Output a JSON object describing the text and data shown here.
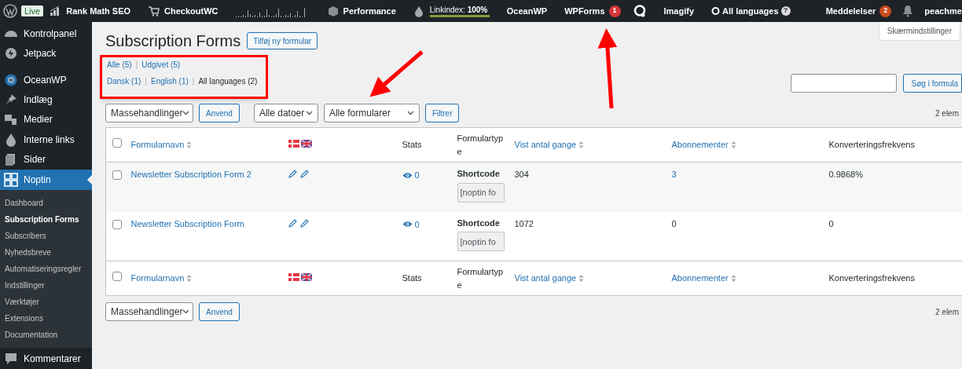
{
  "admin_bar": {
    "live_badge": "Live",
    "left_items": [
      {
        "kind": "chart",
        "label": "Rank Math SEO"
      },
      {
        "kind": "cart",
        "label": "CheckoutWC"
      },
      {
        "kind": "graph"
      },
      {
        "kind": "cube",
        "label": "Performance"
      },
      {
        "kind": "linkindex",
        "label": "Linkindex: **100%**",
        "level": 1.0
      },
      {
        "kind": "text",
        "label": "OceanWP"
      },
      {
        "kind": "count",
        "label": "WPForms",
        "count": "1"
      },
      {
        "kind": "lang-icon"
      },
      {
        "kind": "text",
        "label": "Imagify"
      },
      {
        "kind": "lang",
        "label": "All languages",
        "help": "?"
      }
    ],
    "notifications": {
      "label": "Meddelelser",
      "count": "2"
    },
    "user": "peachme"
  },
  "screen_options": "Skærmindstillinger",
  "sidebar": {
    "sections": [
      [
        {
          "label": "Kontrolpanel",
          "selected": false
        },
        {
          "label": "Jetpack",
          "selected": false
        }
      ],
      [
        {
          "label": "OceanWP",
          "selected": false
        },
        {
          "label": "Indlæg",
          "selected": false
        },
        {
          "label": "Medier",
          "selected": false
        },
        {
          "label": "Interne links",
          "selected": false
        },
        {
          "label": "Sider",
          "selected": false
        },
        {
          "label": "Noptin",
          "selected": true
        }
      ]
    ],
    "submenu": [
      {
        "label": "Dashboard",
        "selected": false
      },
      {
        "label": "Subscription Forms",
        "selected": true
      },
      {
        "label": "Subscribers",
        "selected": false
      },
      {
        "label": "Nyhedsbreve",
        "selected": false
      },
      {
        "label": "Automatiseringsregler",
        "selected": false
      },
      {
        "label": "Indstillinger",
        "selected": false
      },
      {
        "label": "Værktøjer",
        "selected": false
      },
      {
        "label": "Extensions",
        "selected": false
      },
      {
        "label": "Documentation",
        "selected": false
      }
    ],
    "after": [
      {
        "label": "Kommentarer",
        "selected": false
      }
    ]
  },
  "page": {
    "title": "Subscription Forms",
    "add_button": "Tilføj ny formular",
    "status_links": [
      {
        "label": "Alle (5)",
        "selected": false
      },
      {
        "separator": "|",
        "label": "Udgivet (5)",
        "selected": false
      }
    ],
    "language_links": [
      {
        "label": "Dansk (1)",
        "selected": false
      },
      {
        "separator": "|",
        "label": "English (1)",
        "selected": false
      },
      {
        "separator": "|",
        "label": "All languages (2)",
        "selected": true
      }
    ],
    "search_button": "Søg i formula",
    "bulk_actions": "Massehandlinger",
    "apply": "Anvend",
    "dates": "Alle datoer",
    "forms": "Alle formularer",
    "filter": "Filtrer",
    "count": "2 elem"
  },
  "table": {
    "header_checked": false,
    "footer_checked": false,
    "footer_columns": [
      {
        "label": "Formularnavn",
        "sortable": true
      },
      {
        "kind": "flags"
      },
      {
        "label": "Stats",
        "sortable": false
      },
      {
        "label": "Formulartype",
        "sortable": false
      },
      {
        "label": "Vist antal gange",
        "sortable": true
      },
      {
        "label": "Abonnementer",
        "sortable": true
      },
      {
        "label": "Konverteringsfrekvens",
        "sortable": false
      }
    ],
    "columns": [
      {
        "label": "Formularnavn",
        "sortable": true
      },
      {
        "kind": "flags"
      },
      {
        "label": "Stats",
        "sortable": false
      },
      {
        "label": "Formulartype",
        "sortable": false
      },
      {
        "label": "Vist antal gange",
        "sortable": true
      },
      {
        "label": "Abonnementer",
        "sortable": true
      },
      {
        "label": "Konverteringsfrekvens",
        "sortable": false
      }
    ],
    "rows": [
      {
        "checked": false,
        "name": "Newsletter Subscription Form 2",
        "stats": "0",
        "type": "Shortcode",
        "shortcode": "[noptin fo",
        "views": "304",
        "subscribers": "3",
        "subscribers_linked": true,
        "conversion": "0.9868%"
      },
      {
        "checked": false,
        "name": "Newsletter Subscription Form",
        "stats": "0",
        "type": "Shortcode",
        "shortcode": "[noptin fo",
        "views": "1072",
        "subscribers": "0",
        "subscribers_linked": false,
        "conversion": "0"
      }
    ]
  },
  "bottom": {
    "bulk_actions": "Massehandlinger",
    "apply": "Anvend",
    "count": "2 elem"
  }
}
